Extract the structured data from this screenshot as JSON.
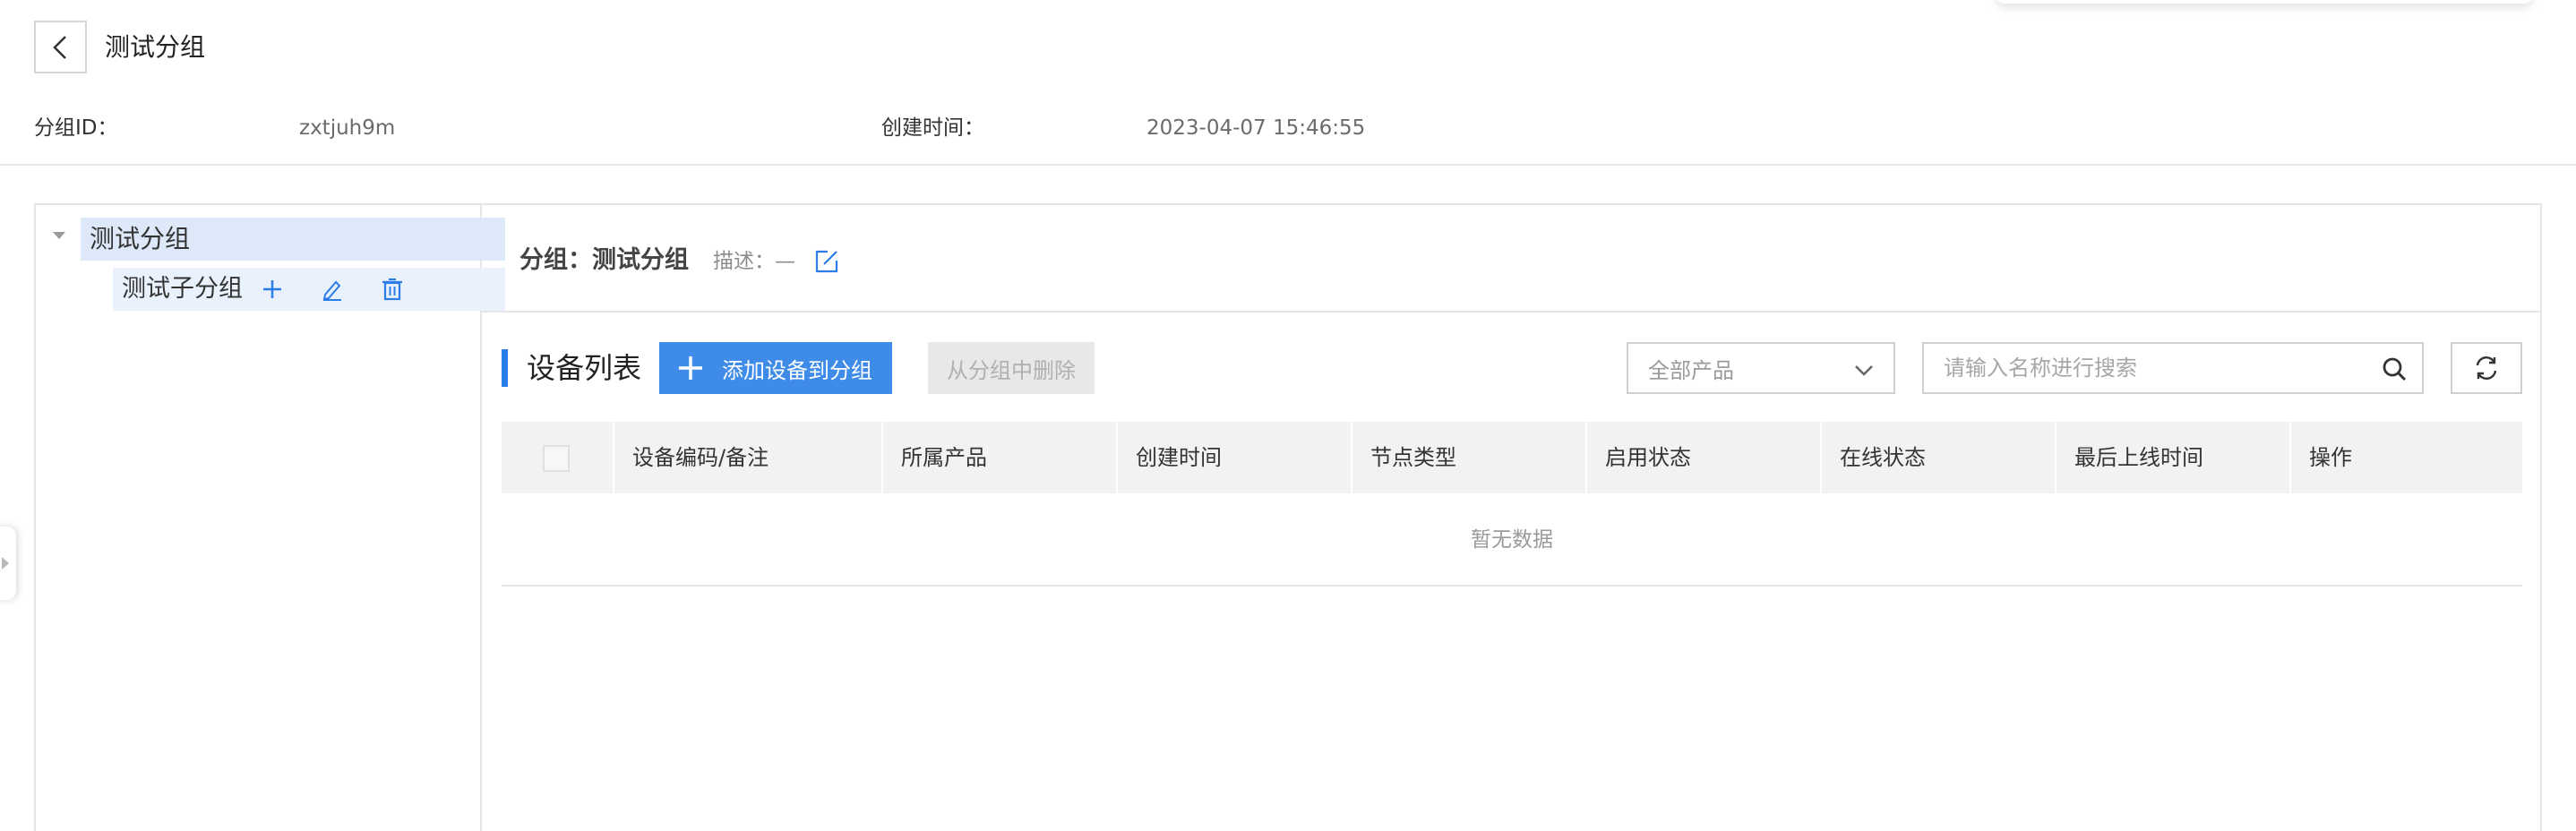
{
  "header": {
    "title": "测试分组",
    "meta": {
      "group_id_label": "分组ID：",
      "group_id_value": "zxtjuh9m",
      "created_label": "创建时间：",
      "created_value": "2023-04-07 15:46:55"
    }
  },
  "tree": {
    "root_label": "测试分组",
    "child_label": "测试子分组"
  },
  "group_info": {
    "title": "分组：测试分组",
    "desc_label": "描述：",
    "desc_value": "—"
  },
  "device_list": {
    "title": "设备列表",
    "add_button": "添加设备到分组",
    "remove_button": "从分组中删除",
    "product_select_value": "全部产品",
    "search_placeholder": "请输入名称进行搜索",
    "columns": [
      "设备编码/备注",
      "所属产品",
      "创建时间",
      "节点类型",
      "启用状态",
      "在线状态",
      "最后上线时间",
      "操作"
    ],
    "empty_text": "暂无数据"
  },
  "colors": {
    "primary": "#3f8be8",
    "tree_selected": "#dde9f8",
    "accent_bar": "#2b7de9"
  }
}
